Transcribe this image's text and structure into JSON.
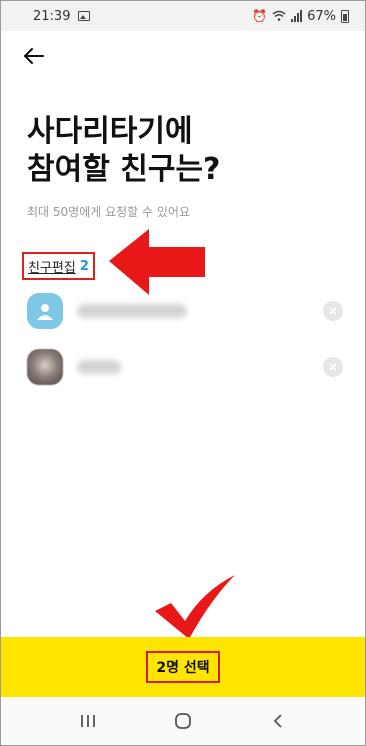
{
  "status_bar": {
    "time": "21:39",
    "battery": "67%",
    "icons": [
      "image-icon",
      "alarm-icon",
      "wifi-icon",
      "signal-icon",
      "battery-icon"
    ]
  },
  "header": {
    "title_line1": "사다리타기에",
    "title_line2": "참여할 친구는?",
    "subtitle": "최대 50명에게 요청할 수 있어요"
  },
  "friend_edit": {
    "label": "친구편집",
    "count": "2"
  },
  "friends": [
    {
      "avatar": "default-profile-icon"
    },
    {
      "avatar": "photo"
    }
  ],
  "footer": {
    "select_label": "2명 선택",
    "accent": "#fee500"
  },
  "annotations": {
    "arrow_color": "#e81818",
    "check_color": "#e81818"
  }
}
